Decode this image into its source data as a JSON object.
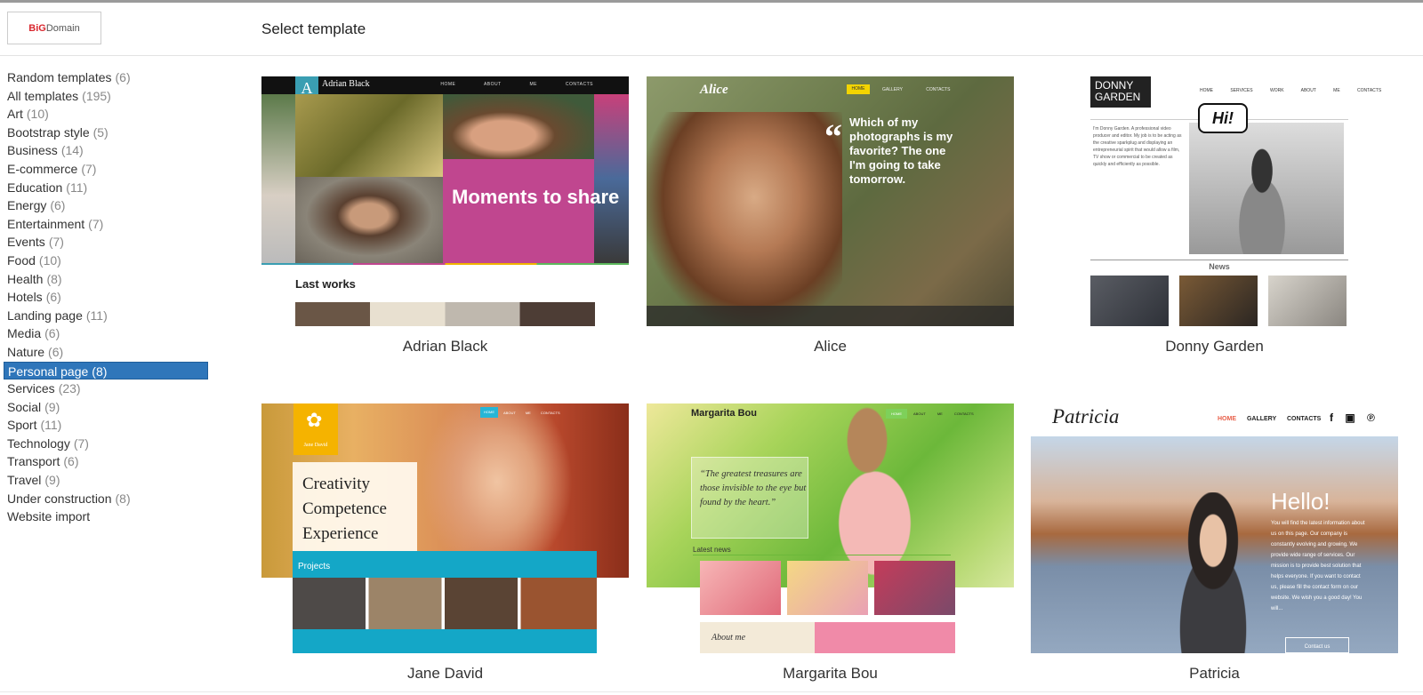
{
  "header": {
    "logo_big": "BiG",
    "logo_domain": "Domain",
    "title": "Select template"
  },
  "sidebar": {
    "categories": [
      {
        "label": "Random templates",
        "count": "(6)"
      },
      {
        "label": "All templates",
        "count": "(195)"
      },
      {
        "label": "Art",
        "count": "(10)"
      },
      {
        "label": "Bootstrap style",
        "count": "(5)"
      },
      {
        "label": "Business",
        "count": "(14)"
      },
      {
        "label": "E-commerce",
        "count": "(7)"
      },
      {
        "label": "Education",
        "count": "(11)"
      },
      {
        "label": "Energy",
        "count": "(6)"
      },
      {
        "label": "Entertainment",
        "count": "(7)"
      },
      {
        "label": "Events",
        "count": "(7)"
      },
      {
        "label": "Food",
        "count": "(10)"
      },
      {
        "label": "Health",
        "count": "(8)"
      },
      {
        "label": "Hotels",
        "count": "(6)"
      },
      {
        "label": "Landing page",
        "count": "(11)"
      },
      {
        "label": "Media",
        "count": "(6)"
      },
      {
        "label": "Nature",
        "count": "(6)"
      },
      {
        "label": "Personal page",
        "count": "(8)"
      },
      {
        "label": "Services",
        "count": "(23)"
      },
      {
        "label": "Social",
        "count": "(9)"
      },
      {
        "label": "Sport",
        "count": "(11)"
      },
      {
        "label": "Technology",
        "count": "(7)"
      },
      {
        "label": "Transport",
        "count": "(6)"
      },
      {
        "label": "Travel",
        "count": "(9)"
      },
      {
        "label": "Under construction",
        "count": "(8)"
      },
      {
        "label": "Website import",
        "count": ""
      }
    ],
    "active_index": 16,
    "active_color": "#2f76ba"
  },
  "templates": [
    {
      "name": "Adrian Black",
      "preview": {
        "site_name": "Adrian Black",
        "ribbon_letter": "A",
        "nav": "HOME ABOUT ME CONTACTS",
        "headline": "Moments to share",
        "section": "Last works"
      }
    },
    {
      "name": "Alice",
      "preview": {
        "site_name": "Alice",
        "nav_home": "HOME",
        "nav": "GALLERY CONTACTS",
        "quote": "Which of my photographs is my favorite? The one I'm going to take tomorrow."
      }
    },
    {
      "name": "Donny Garden",
      "preview": {
        "logo": "DONNY GARDEN",
        "nav": "HOME SERVICES WORK ABOUT ME CONTACTS",
        "bubble": "Hi!",
        "intro": "I'm Donny Garden. A professional video producer and editor. My job is to be acting as the creative sparkplug and displaying an entrepreneurial spirit that would allow a film, TV show or commercial to be created as quickly and efficiently as possible.",
        "section": "News"
      }
    },
    {
      "name": "Jane David",
      "preview": {
        "logo": "Jane David",
        "nav_home": "HOME",
        "nav": "ABOUT ME CONTACTS",
        "line1": "Creativity",
        "line2": "Competence",
        "line3": "Experience",
        "section": "Projects"
      }
    },
    {
      "name": "Margarita Bou",
      "preview": {
        "site_name": "Margarita Bou",
        "nav_home": "HOME",
        "nav": "ABOUT ME CONTACTS",
        "quote": "“The greatest treasures are those invisible to the eye but found by the heart.”",
        "news": "Latest news",
        "about": "About me"
      }
    },
    {
      "name": "Patricia",
      "preview": {
        "site_name": "Patricia",
        "nav_home": "HOME",
        "nav": "GALLERY CONTACTS",
        "social": "f ▣ ℗",
        "hello": "Hello!",
        "text": "You will find the latest information about us on this page. Our company is constantly evolving and growing. We provide wide range of services. Our mission is to provide best solution that helps everyone. If you want to contact us, please fill the contact form on our website. We wish you a good day! You will...",
        "button": "Contact us"
      }
    }
  ]
}
